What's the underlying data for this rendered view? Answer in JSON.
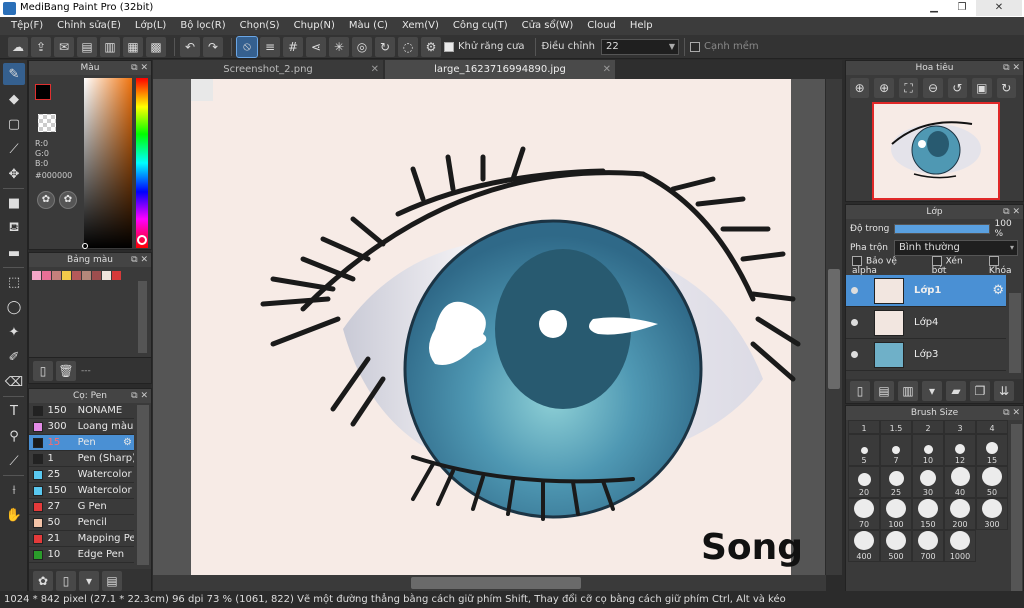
{
  "window": {
    "title": "MediBang Paint Pro (32bit)"
  },
  "menu": [
    "Tệp(F)",
    "Chỉnh sửa(E)",
    "Lớp(L)",
    "Bộ lọc(R)",
    "Chọn(S)",
    "Chụp(N)",
    "Màu (C)",
    "Xem(V)",
    "Công cụ(T)",
    "Cửa sổ(W)",
    "Cloud",
    "Help"
  ],
  "toolbar": {
    "antialias_label": "Khử răng cưa",
    "adjust_label": "Điều chỉnh",
    "adjust_value": "22",
    "soft_edge_label": "Cạnh mềm"
  },
  "color_panel": {
    "title": "Màu",
    "r": "R:0",
    "g": "G:0",
    "b": "B:0",
    "hex": "#000000"
  },
  "swatch_panel": {
    "title": "Bảng màu",
    "colors": [
      "#f4a6c8",
      "#e86f96",
      "#c4807c",
      "#f2c84a",
      "#b55a5a",
      "#b4887a",
      "#9e4e4e",
      "#f0e4dc",
      "#d63a3a"
    ],
    "more_label": "---"
  },
  "brush_panel": {
    "title": "Cọ: Pen",
    "items": [
      {
        "size": "150",
        "name": "NONAME",
        "color": "#222222"
      },
      {
        "size": "300",
        "name": "Loang màu",
        "color": "#e48ce8"
      },
      {
        "size": "15",
        "name": "Pen",
        "color": "#1a1a1a"
      },
      {
        "size": "1",
        "name": "Pen (Sharp)",
        "color": "#222222"
      },
      {
        "size": "25",
        "name": "Watercolor",
        "color": "#59c8f0"
      },
      {
        "size": "150",
        "name": "Watercolor (V",
        "color": "#59c8f0"
      },
      {
        "size": "27",
        "name": "G Pen",
        "color": "#e43a3a"
      },
      {
        "size": "50",
        "name": "Pencil",
        "color": "#f4c4a8"
      },
      {
        "size": "21",
        "name": "Mapping Pen",
        "color": "#e43a3a"
      },
      {
        "size": "10",
        "name": "Edge Pen",
        "color": "#2a9c2a"
      }
    ]
  },
  "tabs": [
    {
      "label": "Screenshot_2.png",
      "active": false
    },
    {
      "label": "large_1623716994890.jpg",
      "active": true
    }
  ],
  "canvas": {
    "signature": "Song"
  },
  "navigator": {
    "title": "Hoa tiêu"
  },
  "layer_panel": {
    "title": "Lớp",
    "opacity_label": "Độ trong",
    "opacity_value": "100 %",
    "opacity_fraction": 1.0,
    "blend_label": "Pha trộn",
    "blend_value": "Bình thường",
    "protect_alpha": "Bảo vệ alpha",
    "clip": "Xén bớt",
    "lock": "Khóa",
    "layers": [
      {
        "name": "Lớp1",
        "selected": true
      },
      {
        "name": "Lớp4",
        "selected": false
      },
      {
        "name": "Lớp3",
        "selected": false
      }
    ]
  },
  "brush_size_panel": {
    "title": "Brush Size",
    "sizes": [
      "1",
      "1.5",
      "2",
      "3",
      "4",
      "5",
      "7",
      "10",
      "12",
      "15",
      "20",
      "25",
      "30",
      "40",
      "50",
      "70",
      "100",
      "150",
      "200",
      "300",
      "400",
      "500",
      "700",
      "1000"
    ]
  },
  "status": {
    "canvas_size": "1024 * 842 pixel",
    "physical": "(27.1 * 22.3cm)",
    "dpi": "96 dpi",
    "zoom": "73 %",
    "cursor": "(1061, 822)",
    "hint": "Vẽ một đường thẳng bằng cách giữ phím Shift, Thay đổi cỡ cọ bằng cách giữ phím Ctrl, Alt và kéo"
  }
}
